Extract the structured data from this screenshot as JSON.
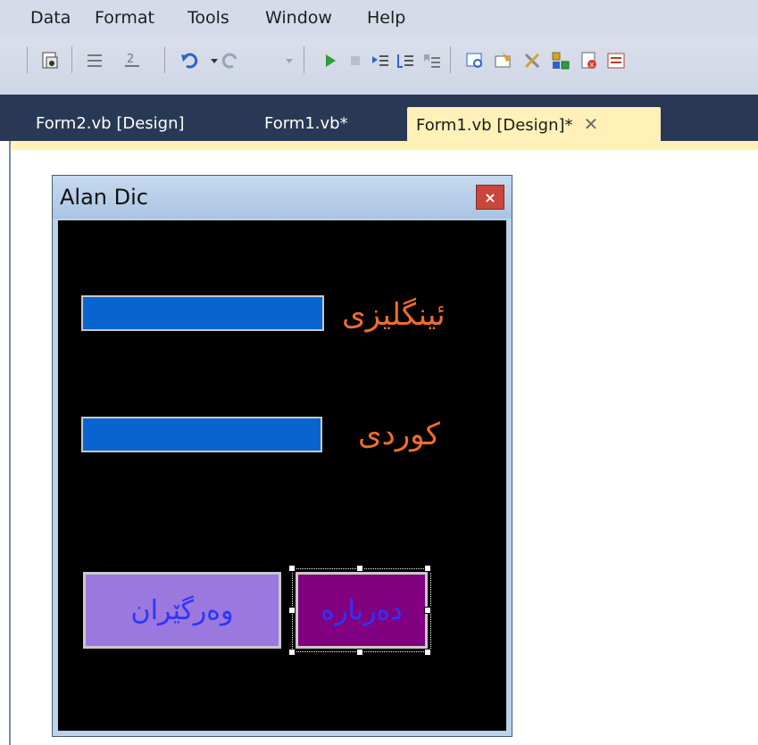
{
  "menu": {
    "items": [
      "Data",
      "Format",
      "Tools",
      "Window",
      "Help"
    ]
  },
  "toolbar": {
    "buttons": [
      "save-all-icon",
      "comment-icon",
      "uncomment-icon",
      "undo-icon",
      "redo-icon",
      "start-icon",
      "stop-icon",
      "indent-icon",
      "outdent-icon",
      "bookmark-icon",
      "solution-explorer-icon",
      "properties-icon",
      "toolbox-icon",
      "object-browser-icon",
      "error-list-icon",
      "output-icon"
    ],
    "colors": {
      "start": "#2e9d3a",
      "undo": "#2a64c8"
    }
  },
  "tabs": [
    {
      "label": "Form2.vb [Design]",
      "active": false
    },
    {
      "label": "Form1.vb*",
      "active": false
    },
    {
      "label": "Form1.vb [Design]*",
      "active": true
    }
  ],
  "tab_close_glyph": "✕",
  "form": {
    "title": "Alan Dic",
    "close_glyph": "×",
    "label_english": "ئینگلیزی",
    "label_kurdish": "کوردی",
    "button_translate": "وەرگێران",
    "button_about": "دەربارە",
    "colors": {
      "client": "#000000",
      "textbox": "#0a64d0",
      "label": "#ef6d2c",
      "button_translate_bg": "#9b78dd",
      "button_about_bg": "#800080",
      "button_text": "#2b35ff"
    }
  }
}
